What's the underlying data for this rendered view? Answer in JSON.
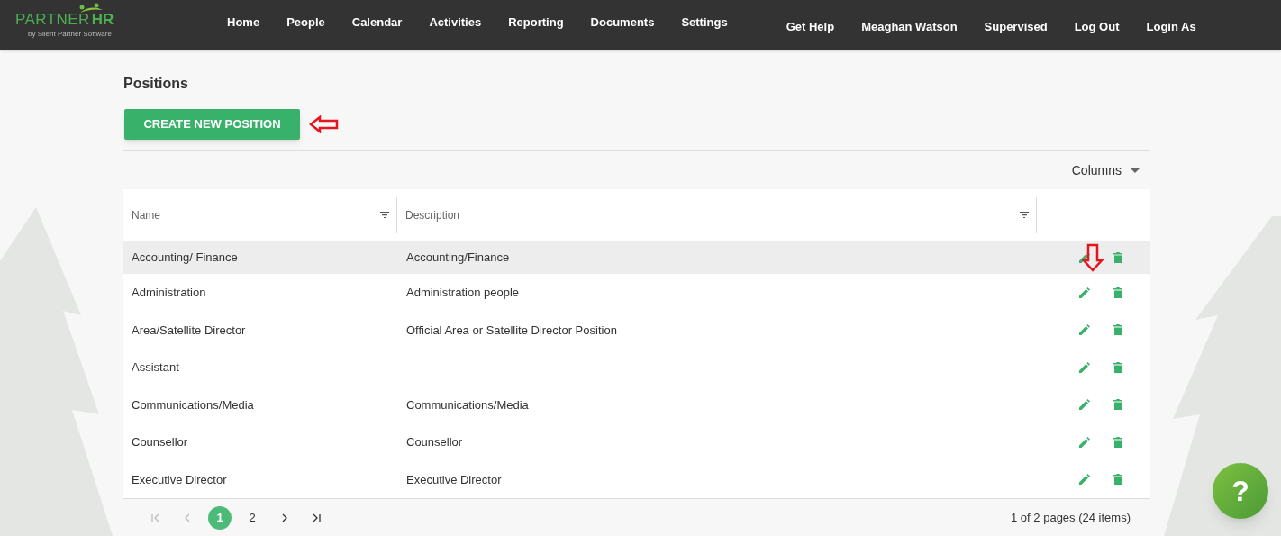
{
  "logo": {
    "brand": "PARTNER",
    "brand_accent": "HR",
    "tagline": "by Silent Partner Software"
  },
  "nav": [
    "Home",
    "People",
    "Calendar",
    "Activities",
    "Reporting",
    "Documents",
    "Settings"
  ],
  "user_nav": [
    "Get Help",
    "Meaghan Watson",
    "Supervised",
    "Log Out",
    "Login As"
  ],
  "page_title": "Positions",
  "create_button": "CREATE NEW POSITION",
  "columns_menu": "Columns",
  "table": {
    "columns": [
      "Name",
      "Description"
    ],
    "rows": [
      {
        "name": "Accounting/ Finance",
        "description": "Accounting/Finance",
        "selected": true
      },
      {
        "name": "Administration",
        "description": "Administration people",
        "selected": false
      },
      {
        "name": "Area/Satellite Director",
        "description": "Official Area or Satellite Director Position",
        "selected": false
      },
      {
        "name": "Assistant",
        "description": "",
        "selected": false
      },
      {
        "name": "Communications/Media",
        "description": "Communications/Media",
        "selected": false
      },
      {
        "name": "Counsellor",
        "description": "Counsellor",
        "selected": false
      },
      {
        "name": "Executive Director",
        "description": "Executive Director",
        "selected": false
      }
    ]
  },
  "pager": {
    "pages": [
      {
        "label": "1",
        "selected": true
      },
      {
        "label": "2",
        "selected": false
      }
    ],
    "summary": "1 of 2 pages (24 items)"
  },
  "help_button": "?"
}
